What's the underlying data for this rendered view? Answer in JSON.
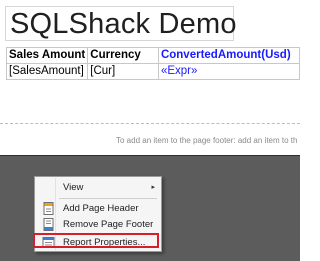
{
  "report": {
    "title": "SQLShack Demo",
    "table": {
      "headers": [
        "Sales Amount",
        "Currency",
        "ConvertedAmount(Usd)"
      ],
      "row": [
        "[SalesAmount]",
        "[Cur]",
        "«Expr»"
      ]
    }
  },
  "footer": {
    "hint": "To add an item to the page footer: add an item to th"
  },
  "context_menu": {
    "items": [
      {
        "label": "View",
        "icon": "none",
        "submenu_arrow": "▸"
      },
      {
        "label": "Add Page Header",
        "icon": "page-header-icon"
      },
      {
        "label": "Remove Page Footer",
        "icon": "page-footer-icon"
      },
      {
        "label": "Report Properties...",
        "icon": "report-properties-icon"
      }
    ]
  },
  "colors": {
    "accent_blue": "#1a1aff",
    "highlight_red": "#d81e2a",
    "canvas_gray": "#5c5c5c"
  }
}
